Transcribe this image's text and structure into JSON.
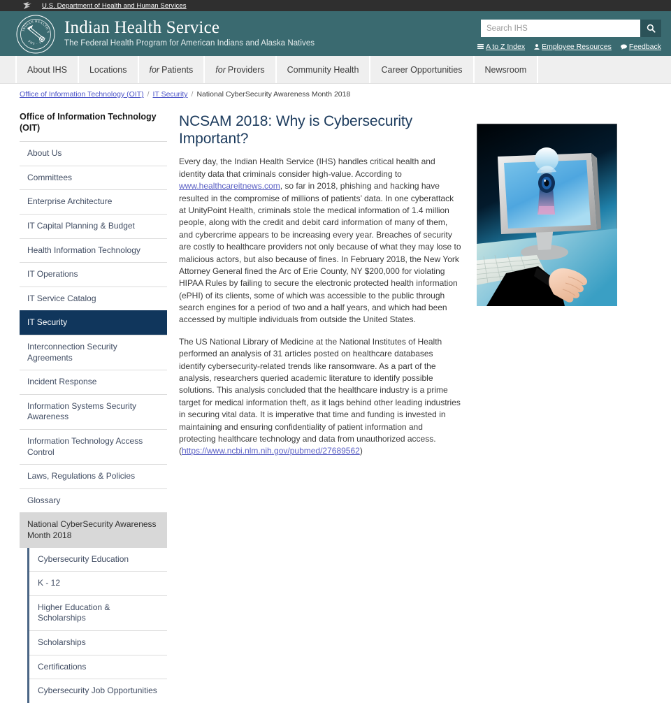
{
  "hhs_banner": {
    "link_label": "U.S. Department of Health and Human Services",
    "flag_icon": "hhs-flag-icon"
  },
  "masthead": {
    "seal_alt": "ihs-seal",
    "seal_ring_top": "INDIAN HEALTH SERVICE",
    "seal_ring_bottom": "PHS · 1955",
    "title": "Indian Health Service",
    "subtitle": "The Federal Health Program for American Indians and Alaska Natives",
    "accent_color": "#3a6a70"
  },
  "search": {
    "placeholder": "Search IHS",
    "value": "",
    "button_icon": "search-icon",
    "button_label": "Search"
  },
  "utility_links": [
    {
      "label": "A to Z Index",
      "icon": "list-icon",
      "glyph": "☰"
    },
    {
      "label": "Employee Resources",
      "icon": "user-icon",
      "glyph": "♟"
    },
    {
      "label": "Feedback",
      "icon": "comment-icon",
      "glyph": "●"
    }
  ],
  "main_nav": [
    {
      "label": "About IHS",
      "italic_prefix": ""
    },
    {
      "label": "Locations",
      "italic_prefix": ""
    },
    {
      "label": "Patients",
      "italic_prefix": "for"
    },
    {
      "label": "Providers",
      "italic_prefix": "for"
    },
    {
      "label": "Community Health",
      "italic_prefix": ""
    },
    {
      "label": "Career Opportunities",
      "italic_prefix": ""
    },
    {
      "label": "Newsroom",
      "italic_prefix": ""
    }
  ],
  "breadcrumb": {
    "items": [
      {
        "label": "Office of Information Technology (OIT)",
        "link": true
      },
      {
        "label": "IT Security",
        "link": true
      },
      {
        "label": "National CyberSecurity Awareness Month 2018",
        "link": false
      }
    ],
    "separator": "/"
  },
  "sidebar": {
    "heading": "Office of Information Technology (OIT)",
    "items": [
      {
        "label": "About Us",
        "state": "normal"
      },
      {
        "label": "Committees",
        "state": "normal"
      },
      {
        "label": "Enterprise Architecture",
        "state": "normal"
      },
      {
        "label": "IT Capital Planning & Budget",
        "state": "normal"
      },
      {
        "label": "Health Information Technology",
        "state": "normal"
      },
      {
        "label": "IT Operations",
        "state": "normal"
      },
      {
        "label": "IT Service Catalog",
        "state": "normal"
      },
      {
        "label": "IT Security",
        "state": "active"
      },
      {
        "label": "Interconnection Security Agreements",
        "state": "normal"
      },
      {
        "label": "Incident Response",
        "state": "normal"
      },
      {
        "label": "Information Systems Security Awareness",
        "state": "normal"
      },
      {
        "label": "Information Technology Access Control",
        "state": "normal"
      },
      {
        "label": "Laws, Regulations & Policies",
        "state": "normal"
      },
      {
        "label": "Glossary",
        "state": "normal"
      },
      {
        "label": "National CyberSecurity Awareness Month 2018",
        "state": "current"
      }
    ],
    "sub_items": [
      {
        "label": "Cybersecurity Education"
      },
      {
        "label": "K - 12"
      },
      {
        "label": "Higher Education & Scholarships"
      },
      {
        "label": "Scholarships"
      },
      {
        "label": "Certifications"
      },
      {
        "label": "Cybersecurity Job Opportunities"
      }
    ],
    "active_color": "#10365c",
    "current_color": "#d8d8d8"
  },
  "article": {
    "title": "NCSAM 2018: Why is Cybersecurity Important?",
    "paragraph1_part1": "Every day, the Indian Health Service (IHS) handles critical health and identity data that criminals consider high-value. According to ",
    "paragraph1_link": "www.healthcareitnews.com",
    "paragraph1_part2": ", so far in 2018, phishing and hacking have resulted in the compromise of millions of patients’ data. In one cyberattack at UnityPoint Health, criminals stole the medical information of 1.4 million people, along with the credit and debit card information of many of them, and cybercrime appears to be increasing every year. Breaches of security are costly to healthcare providers not only because of what they may lose to malicious actors, but also because of fines. In February 2018, the New York Attorney General fined the Arc of Erie County, NY $200,000 for violating HIPAA Rules by failing to secure the electronic protected health information (ePHI) of its clients, some of which was accessible to the public through search engines for a period of two and a half years, and which had been accessed by multiple individuals from outside the United States.",
    "paragraph2_part1": "The US National Library of Medicine at the National Institutes of Health performed an analysis of 31 articles posted on healthcare databases identify cybersecurity-related trends like ransomware. As a part of the analysis, researchers queried academic literature to identify possible solutions. This analysis concluded that the healthcare industry is a prime target for medical information theft, as it lags behind other leading industries in securing vital data. It is imperative that time and funding is invested in maintaining and ensuring confidentiality of patient information and protecting healthcare technology and data from unauthorized access. (",
    "paragraph2_link": "https://www.ncbi.nlm.nih.gov/pubmed/27689562",
    "paragraph2_part2": ")",
    "figure_alt": "cybersecurity-illustration-monitor-keyhole-eye"
  }
}
